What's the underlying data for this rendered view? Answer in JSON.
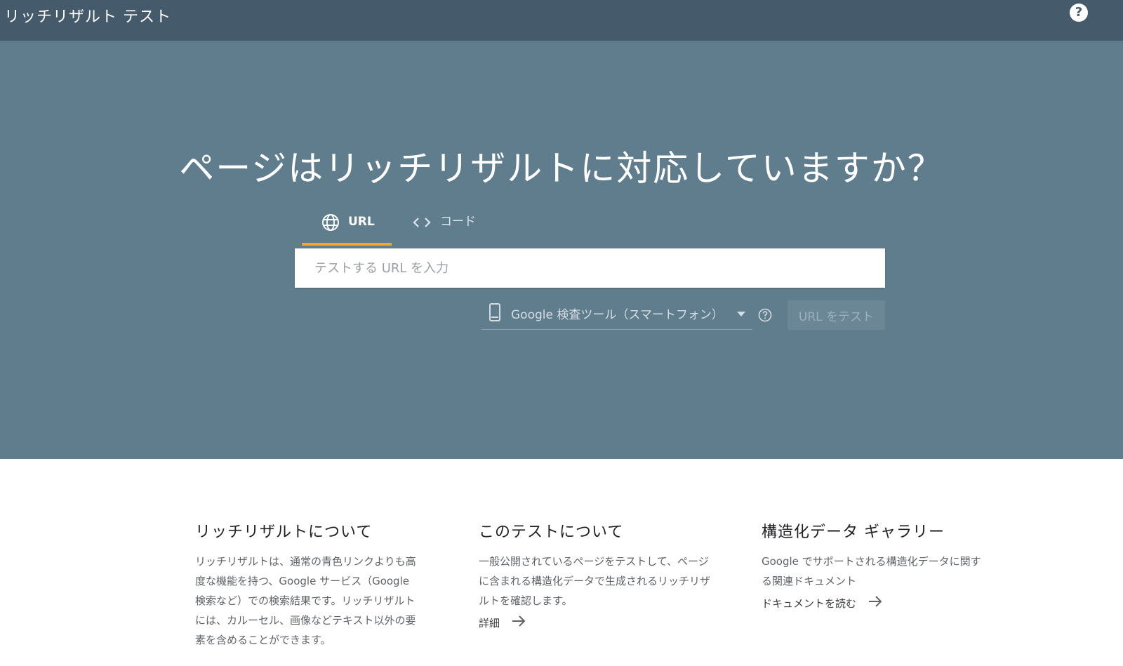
{
  "header": {
    "app_title": "リッチリザルト テスト",
    "help_icon": "help-circle-icon",
    "help_symbol": "?"
  },
  "hero": {
    "headline": "ページはリッチリザルトに対応していますか？",
    "tabs": [
      {
        "label": "URL",
        "icon": "globe-icon",
        "selected": true
      },
      {
        "label": "コード",
        "icon": "code-icon",
        "selected": false
      }
    ],
    "url_input": {
      "placeholder": "テストする URL を入力",
      "value": ""
    },
    "crawler_select": {
      "icon": "smartphone-icon",
      "selected": "Google 検査ツール（スマートフォン）"
    },
    "test_button_label": "URL をテスト",
    "accent_color": "#f5a623"
  },
  "info": [
    {
      "title": "リッチリザルトについて",
      "text": "リッチリザルトは、通常の青色リンクよりも高度な機能を持つ、Google サービス（Google 検索など）での検索結果です。リッチリザルトには、カルーセル、画像などテキスト以外の要素を含めることができます。"
    },
    {
      "title": "このテストについて",
      "text": "一般公開されているページをテストして、ページに含まれる構造化データで生成されるリッチリザルトを確認します。",
      "link": "詳細"
    },
    {
      "title": "構造化データ ギャラリー",
      "text": "Google でサポートされる構造化データに関する関連ドキュメント",
      "link": "ドキュメントを読む"
    }
  ]
}
